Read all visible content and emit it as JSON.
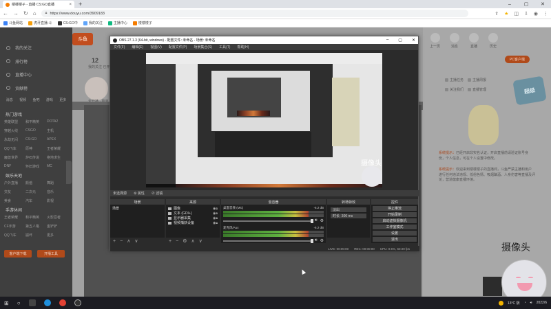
{
  "browser": {
    "tab_title": "楼楼楼子 - 直播 CS:GO直播",
    "tab_close": "×",
    "new_tab": "+",
    "url": "https://www.douyu.com/3909183",
    "window_controls": [
      "–",
      "▢",
      "✕"
    ],
    "bookmarks": [
      "斗鱼网站",
      "虎牙直播-斗",
      "CS:GO中",
      "我的关注",
      "主播中心",
      "楼楼楼子"
    ],
    "bookmark_colors": [
      "#3b82f6",
      "#f59e0b",
      "#333333",
      "#60a5fa",
      "#10b981",
      "#f57c00"
    ]
  },
  "douyu": {
    "sidebar_items": [
      "我的关注",
      "排行榜",
      "直播中心",
      "贡献榜"
    ],
    "sidebar_icons_label": [
      "消息",
      "视频",
      "鱼吧",
      "游戏",
      "更多"
    ],
    "category_header": "热门游戏",
    "categories": [
      "英雄联盟",
      "和平精英",
      "DOTA2",
      "穿越火线",
      "CSGO",
      "主机",
      "永劫无间",
      "CS:GO",
      "APEX",
      "QQ飞车",
      "原神",
      "王者荣耀",
      "魔兽世界",
      "炉石传说",
      "绝地求生",
      "DNF",
      "怀旧游戏",
      "MC"
    ],
    "category_header_2": "娱乐天地",
    "categories_2": [
      "户外直播",
      "颜值",
      "舞蹈",
      "交友",
      "二次元",
      "音乐",
      "美食",
      "汽车",
      "影视"
    ],
    "category_header_3": "手游休闲",
    "categories_3": [
      "王者荣耀",
      "和平精英",
      "火影忍者",
      "CF手游",
      "第五人格",
      "金铲铲",
      "QQ飞车",
      "崩坏",
      "更多"
    ],
    "side_buttons": [
      "客户端下载",
      "开播工具"
    ],
    "follow_count": "12",
    "follow_sub": "我的关注  已开播",
    "live_tag": "未开播 · 距离",
    "right_icons": [
      "上一页",
      "消息",
      "直播",
      "历史",
      "头像"
    ],
    "pc_button": "PC客户端",
    "right_chips": [
      [
        "主播任务",
        "主播周报"
      ],
      [
        "关注我们",
        "直播管理"
      ]
    ],
    "badge": "超级",
    "messages": [
      {
        "tag": "系统提示：",
        "text": "已经开启非实名认证，开启直播前请验证账号身份，个人信息，可在个人设置中修改。"
      },
      {
        "tag": "系统提示：",
        "text": "欢迎来到楼楼楼子的直播间，斗鱼严禁主播和用户进行任何违法违规、低俗色情、吸烟酗酒、人身伤害等直播及评论，营造健康直播环境。"
      }
    ],
    "camera_label": "摄像头"
  },
  "obs": {
    "title": "OBS 27.1.3 (64-bit, windows) - 配置文件: 未命名 - 场景: 未命名",
    "title_controls": [
      "–",
      "▢",
      "✕"
    ],
    "menu": [
      "文件(F)",
      "编辑(E)",
      "视图(V)",
      "配置文件(P)",
      "场景集合(S)",
      "工具(T)",
      "帮助(H)"
    ],
    "preview_camera_text": "摄像头",
    "bar": [
      "未选择源",
      "⚙ 属性",
      "⊘ 滤镜"
    ],
    "docks": {
      "scenes": {
        "title": "场景",
        "items": [
          "场景"
        ]
      },
      "sources": {
        "title": "来源",
        "items": [
          {
            "icon": "image",
            "name": "图像"
          },
          {
            "icon": "text",
            "name": "文本 (GDI+)"
          },
          {
            "icon": "monitor",
            "name": "显示器采集"
          },
          {
            "icon": "camera",
            "name": "视频捕获设备"
          }
        ]
      },
      "mixer": {
        "title": "混音器",
        "channels": [
          {
            "name": "桌面音频 (Mic)",
            "db": "-6.2 dB"
          },
          {
            "name": "麦克风/Aux",
            "db": "-6.2 dB"
          }
        ]
      },
      "transitions": {
        "title": "转场特效",
        "select": "淡出",
        "duration_label": "时长",
        "duration_value": "300 ms"
      },
      "controls": {
        "title": "控件",
        "buttons": [
          "停止推流",
          "开始录制",
          "启动虚拟摄像机",
          "工作室模式",
          "设置",
          "退出"
        ]
      }
    },
    "status": [
      "LIVE: 00:00:00",
      "REC: 00:00:00",
      "CPU: 0.5%, 60.00 fps"
    ],
    "foot_icons": [
      "+",
      "−",
      "∧",
      "∨"
    ]
  },
  "taskbar": {
    "start": "⊞",
    "search": "○",
    "weather": "13°C 阴",
    "time": "2022/6"
  }
}
